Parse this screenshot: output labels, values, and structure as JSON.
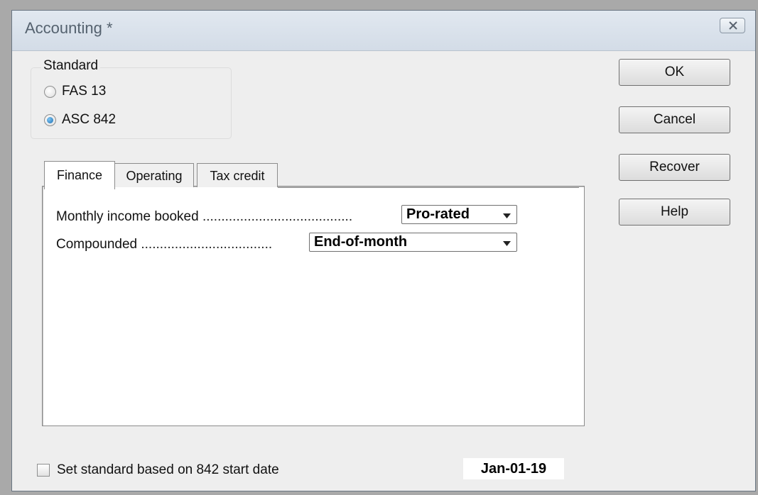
{
  "window": {
    "title": "Accounting *"
  },
  "standard": {
    "label": "Standard",
    "options": [
      {
        "label": "FAS 13",
        "selected": false
      },
      {
        "label": "ASC 842",
        "selected": true
      }
    ]
  },
  "buttons": {
    "ok": "OK",
    "cancel": "Cancel",
    "recover": "Recover",
    "help": "Help"
  },
  "tabs": [
    {
      "label": "Finance",
      "active": true
    },
    {
      "label": "Operating",
      "active": false
    },
    {
      "label": "Tax credit",
      "active": false
    }
  ],
  "finance": {
    "monthly_income_label": "Monthly income booked",
    "monthly_income_dots": "........................................",
    "monthly_income_value": "Pro-rated",
    "compounded_label": "Compounded",
    "compounded_dots": "...................................",
    "compounded_value": "End-of-month"
  },
  "footer": {
    "checkbox_label": "Set standard based on 842 start date",
    "checkbox_checked": false,
    "start_date": "Jan-01-19"
  },
  "icons": {
    "close": "close-icon",
    "dropdown": "chevron-down-icon"
  }
}
